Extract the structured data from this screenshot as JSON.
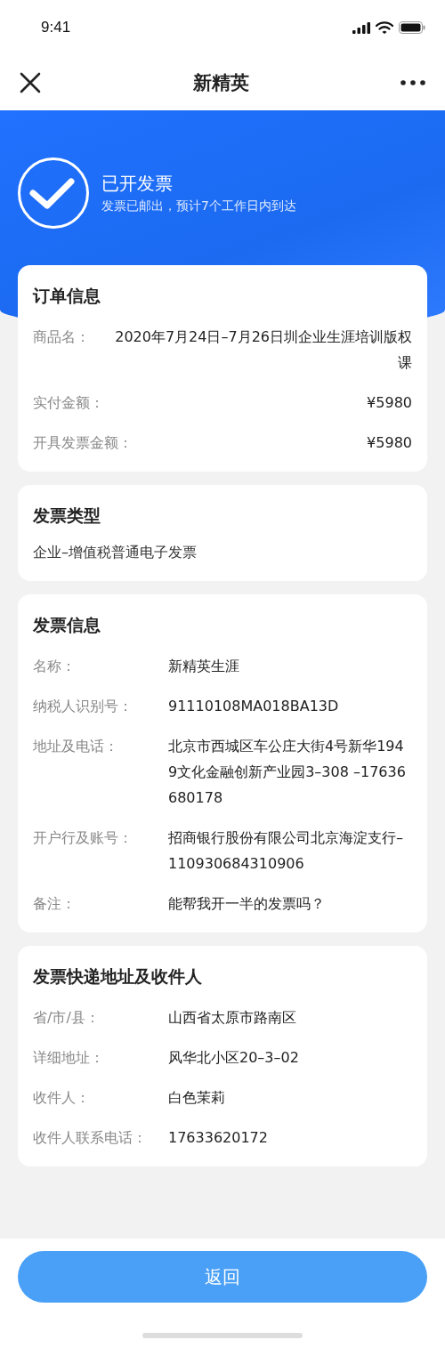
{
  "status_bar": {
    "time": "9:41"
  },
  "nav": {
    "title": "新精英"
  },
  "status": {
    "title": "已开发票",
    "subtitle": "发票已邮出，预计7个工作日内到达"
  },
  "sections": [
    {
      "kind": "split",
      "title": "订单信息",
      "rows": [
        {
          "label": "商品名：",
          "value": "2020年7月24日–7月26日圳企业生涯培训版权课"
        },
        {
          "label": "实付金额：",
          "value": "¥5980"
        },
        {
          "label": "开具发票金额：",
          "value": "¥5980"
        }
      ]
    },
    {
      "kind": "text",
      "title": "发票类型",
      "text": "企业–增值税普通电子发票"
    },
    {
      "kind": "columns",
      "title": "发票信息",
      "rows": [
        {
          "label": "名称：",
          "value": "新精英生涯"
        },
        {
          "label": "纳税人识别号：",
          "value": "91110108MA018BA13D"
        },
        {
          "label": "地址及电话：",
          "value": "北京市西城区车公庄大街4号新华1949文化金融创新产业园3–308 –17636680178"
        },
        {
          "label": "开户行及账号：",
          "value": "招商银行股份有限公司北京海淀支行–110930684310906"
        },
        {
          "label": "备注：",
          "value": "能帮我开一半的发票吗？"
        }
      ]
    },
    {
      "kind": "columns",
      "title": "发票快递地址及收件人",
      "rows": [
        {
          "label": "省/市/县：",
          "value": "山西省太原市路南区"
        },
        {
          "label": "详细地址：",
          "value": "风华北小区20–3–02"
        },
        {
          "label": "收件人：",
          "value": "白色茉莉"
        },
        {
          "label": "收件人联系电话：",
          "value": "17633620172"
        }
      ]
    }
  ],
  "footer": {
    "button": "返回"
  }
}
